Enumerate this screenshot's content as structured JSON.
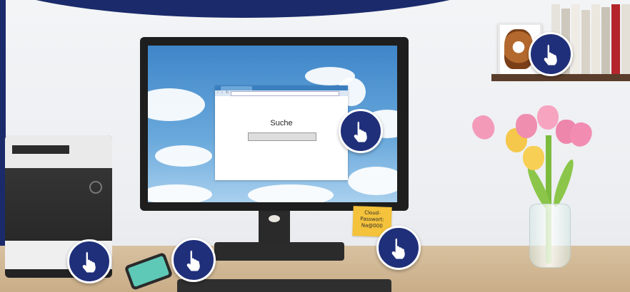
{
  "scene": {
    "computer_screen": {
      "browser": {
        "search_label": "Suche",
        "search_value": ""
      }
    },
    "sticky_note": {
      "line1": "Cloud-",
      "line2": "Passwort:",
      "line3": "Na@000"
    },
    "hotspots": [
      {
        "target": "photo"
      },
      {
        "target": "screen"
      },
      {
        "target": "printer"
      },
      {
        "target": "phone"
      },
      {
        "target": "sticky-note"
      }
    ],
    "icons": {
      "hotspot": "pointing-hand-icon"
    },
    "colors": {
      "badge": "#1f2f7a",
      "band": "#1a2a6b",
      "sticky": "#f4c23b"
    }
  }
}
